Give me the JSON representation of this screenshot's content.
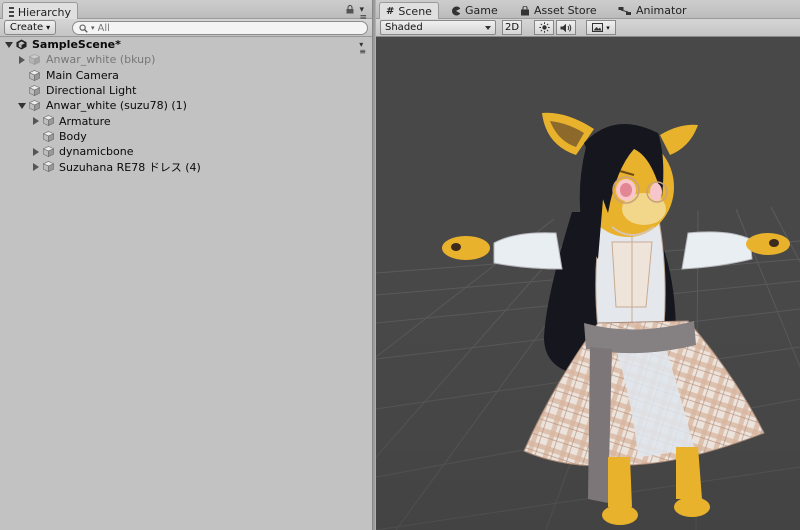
{
  "hierarchy": {
    "tab_label": "Hierarchy",
    "create_label": "Create",
    "search_placeholder": "All",
    "scene_name": "SampleScene*",
    "items": [
      {
        "label": "Anwar_white (bkup)",
        "expandable": true,
        "expanded": false,
        "dim": true
      },
      {
        "label": "Main Camera",
        "expandable": false,
        "dim": false
      },
      {
        "label": "Directional Light",
        "expandable": false,
        "dim": false
      },
      {
        "label": "Anwar_white (suzu78) (1)",
        "expandable": true,
        "expanded": true,
        "dim": false
      },
      {
        "label": "Armature",
        "expandable": true,
        "expanded": false,
        "dim": false
      },
      {
        "label": "Body",
        "expandable": false,
        "dim": false
      },
      {
        "label": "dynamicbone",
        "expandable": true,
        "expanded": false,
        "dim": false
      },
      {
        "label": "Suzuhana RE78 ドレス (4)",
        "expandable": true,
        "expanded": false,
        "dim": false
      }
    ]
  },
  "scene_view": {
    "tabs": [
      {
        "label": "Scene",
        "icon": "hash-icon",
        "active": true
      },
      {
        "label": "Game",
        "icon": "pacman-icon",
        "active": false
      },
      {
        "label": "Asset Store",
        "icon": "bag-icon",
        "active": false
      },
      {
        "label": "Animator",
        "icon": "animator-icon",
        "active": false
      }
    ],
    "shading_mode": "Shaded",
    "mode_2d_label": "2D"
  },
  "colors": {
    "panel_bg": "#c2c2c2",
    "viewport_bg": "#484848",
    "fur": "#e9b22c",
    "hair": "#15161e",
    "dress_plaid": "#e6c8b4"
  }
}
